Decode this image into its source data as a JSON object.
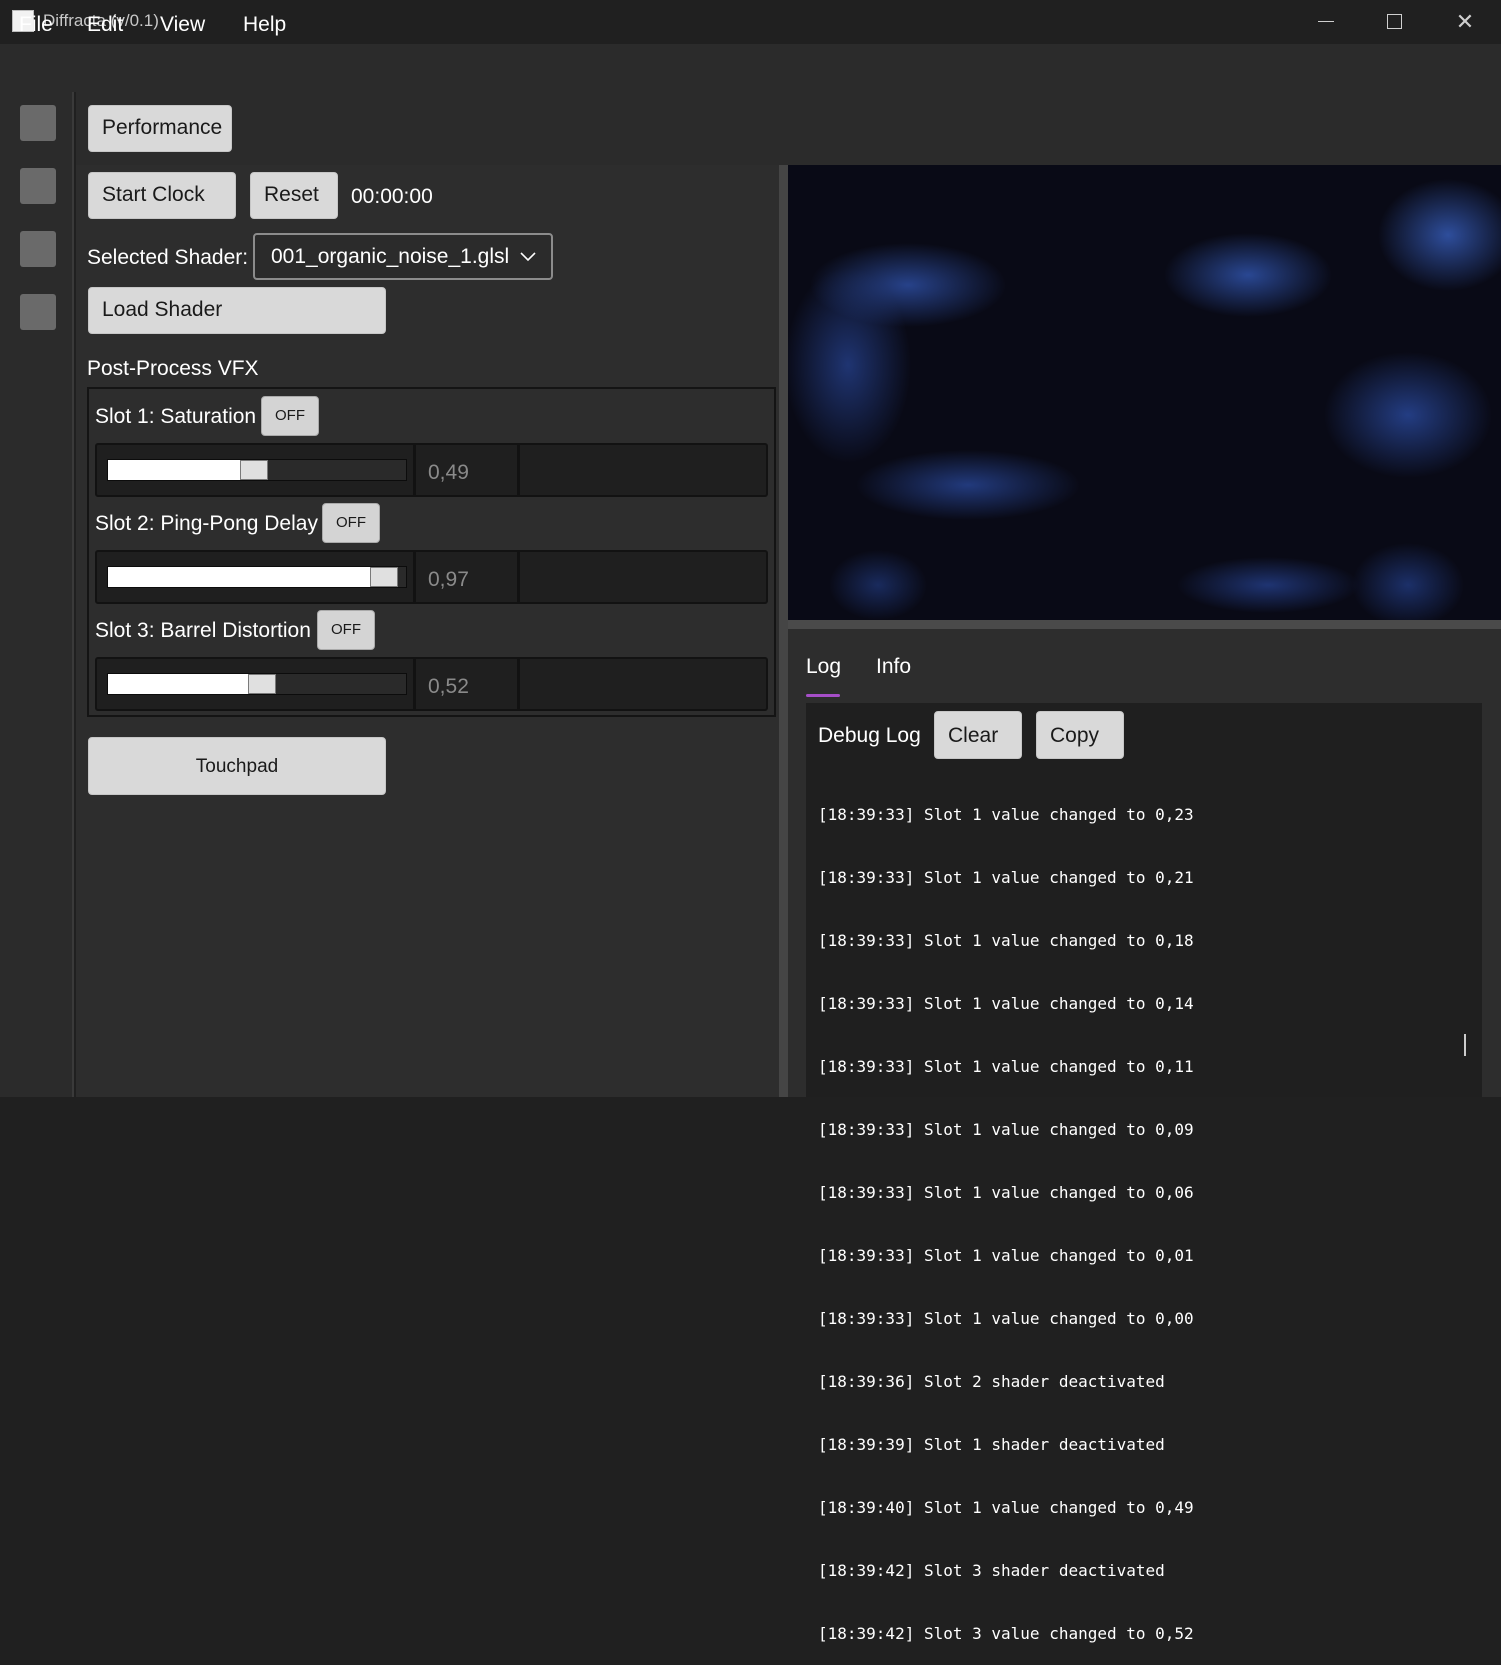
{
  "window": {
    "title": "Diffracta (v/0.1)",
    "controls": {
      "minimize": "minimize-icon",
      "maximize": "maximize-icon",
      "close": "close-icon"
    }
  },
  "menu": [
    "File",
    "Edit",
    "View",
    "Help"
  ],
  "toolbar": {
    "performance_label": "Performance"
  },
  "clock": {
    "start_label": "Start Clock",
    "reset_label": "Reset",
    "time": "00:00:00"
  },
  "shader": {
    "label": "Selected Shader:",
    "selected": "001_organic_noise_1.glsl",
    "load_label": "Load Shader"
  },
  "vfx": {
    "heading": "Post-Process VFX",
    "slots": [
      {
        "label": "Slot 1: Saturation",
        "toggle": "OFF",
        "value": "0,49",
        "level": 0.49
      },
      {
        "label": "Slot 2: Ping-Pong Delay",
        "toggle": "OFF",
        "value": "0,97",
        "level": 0.97
      },
      {
        "label": "Slot 3: Barrel Distortion",
        "toggle": "OFF",
        "value": "0,52",
        "level": 0.52
      }
    ]
  },
  "touchpad_label": "Touchpad",
  "log": {
    "tabs": [
      "Log",
      "Info"
    ],
    "active_tab": "Log",
    "title": "Debug Log",
    "clear_label": "Clear",
    "copy_label": "Copy",
    "lines": [
      "[18:39:33] Slot 1 value changed to 0,23",
      "[18:39:33] Slot 1 value changed to 0,21",
      "[18:39:33] Slot 1 value changed to 0,18",
      "[18:39:33] Slot 1 value changed to 0,14",
      "[18:39:33] Slot 1 value changed to 0,11",
      "[18:39:33] Slot 1 value changed to 0,09",
      "[18:39:33] Slot 1 value changed to 0,06",
      "[18:39:33] Slot 1 value changed to 0,01",
      "[18:39:33] Slot 1 value changed to 0,00",
      "[18:39:36] Slot 2 shader deactivated",
      "[18:39:39] Slot 1 shader deactivated",
      "[18:39:40] Slot 1 value changed to 0,49",
      "[18:39:42] Slot 3 shader deactivated",
      "[18:39:42] Slot 3 value changed to 0,52"
    ]
  },
  "colors": {
    "accent": "#a64ec8",
    "background": "#202020",
    "panel": "#2d2d2d"
  }
}
